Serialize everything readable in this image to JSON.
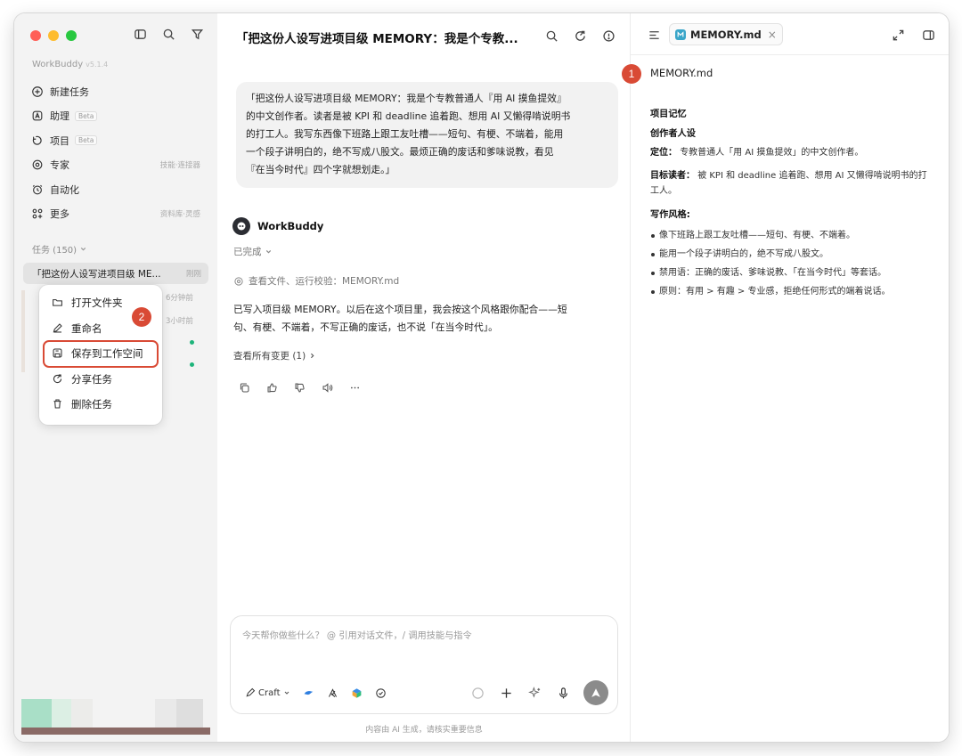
{
  "window": {
    "traffic_colors": [
      "#ff5f57",
      "#febc2e",
      "#28c840"
    ]
  },
  "sidebar": {
    "app_name": "WorkBuddy",
    "version": "v5.1.4",
    "nav": [
      {
        "label": "新建任务",
        "icon": "plus-circle-icon",
        "beta": "",
        "meta": ""
      },
      {
        "label": "助理",
        "icon": "assistant-icon",
        "beta": "Beta",
        "meta": ""
      },
      {
        "label": "项目",
        "icon": "project-icon",
        "beta": "Beta",
        "meta": ""
      },
      {
        "label": "专家",
        "icon": "expert-icon",
        "beta": "",
        "meta": "技能·连接器"
      },
      {
        "label": "自动化",
        "icon": "automation-icon",
        "beta": "",
        "meta": ""
      },
      {
        "label": "更多",
        "icon": "more-grid-icon",
        "beta": "",
        "meta": "资料库·灵感"
      }
    ],
    "tasks_header": "任务 (150)",
    "active_task": {
      "title": "「把这份人设写进项目级 ME...",
      "time": "刚刚"
    },
    "other_times": [
      "6分钟前",
      "3小时前"
    ],
    "accent_dot": "#1db47a"
  },
  "context_menu": {
    "items": [
      {
        "label": "打开文件夹",
        "icon": "folder-icon"
      },
      {
        "label": "重命名",
        "icon": "edit-icon"
      },
      {
        "label": "保存到工作空间",
        "icon": "save-icon"
      },
      {
        "label": "分享任务",
        "icon": "share-icon"
      },
      {
        "label": "删除任务",
        "icon": "trash-icon"
      }
    ],
    "highlight_color": "#d94a35"
  },
  "annotations": {
    "one": "1",
    "two": "2"
  },
  "chat": {
    "title": "「把这份人设写进项目级 MEMORY：我是个专教...",
    "user_message_lines": [
      "「把这份人设写进项目级 MEMORY：我是个专教普通人『用 AI 摸鱼提效』",
      "的中文创作者。读者是被 KPI 和 deadline 追着跑、想用 AI 又懒得啃说明书",
      "的打工人。我写东西像下班路上跟工友吐槽——短句、有梗、不端着，能用",
      "一个段子讲明白的，绝不写成八股文。最烦正确的废话和爹味说教，看见",
      "『在当今时代』四个字就想划走。」"
    ],
    "bot_name": "WorkBuddy",
    "status": "已完成",
    "check_line": "查看文件、运行校验：MEMORY.md",
    "reply_lines": [
      "已写入项目级 MEMORY。以后在这个项目里，我会按这个风格跟你配合——短",
      "句、有梗、不端着，不写正确的废话，也不说「在当今时代」。"
    ],
    "changes": "查看所有变更 (1)",
    "composer_placeholder": "今天帮你做些什么？ @ 引用对话文件，/ 调用技能与指令",
    "craft_label": "Craft",
    "footer_note": "内容由 AI 生成，请核实重要信息"
  },
  "panel": {
    "tab_name": "MEMORY.md",
    "file_name": "MEMORY.md",
    "heading1": "项目记忆",
    "heading2": "创作者人设",
    "position_label": "定位：",
    "position_text": "专教普通人「用 AI 摸鱼提效」的中文创作者。",
    "readers_label": "目标读者：",
    "readers_text": "被 KPI 和 deadline 追着跑、想用 AI 又懒得啃说明书的打工人。",
    "style_heading": "写作风格:",
    "style_items": [
      "像下班路上跟工友吐槽——短句、有梗、不端着。",
      "能用一个段子讲明白的，绝不写成八股文。",
      "禁用语：正确的废话、爹味说教、「在当今时代」等套话。",
      "原则：有用 > 有趣 > 专业感，拒绝任何形式的端着说话。"
    ]
  }
}
